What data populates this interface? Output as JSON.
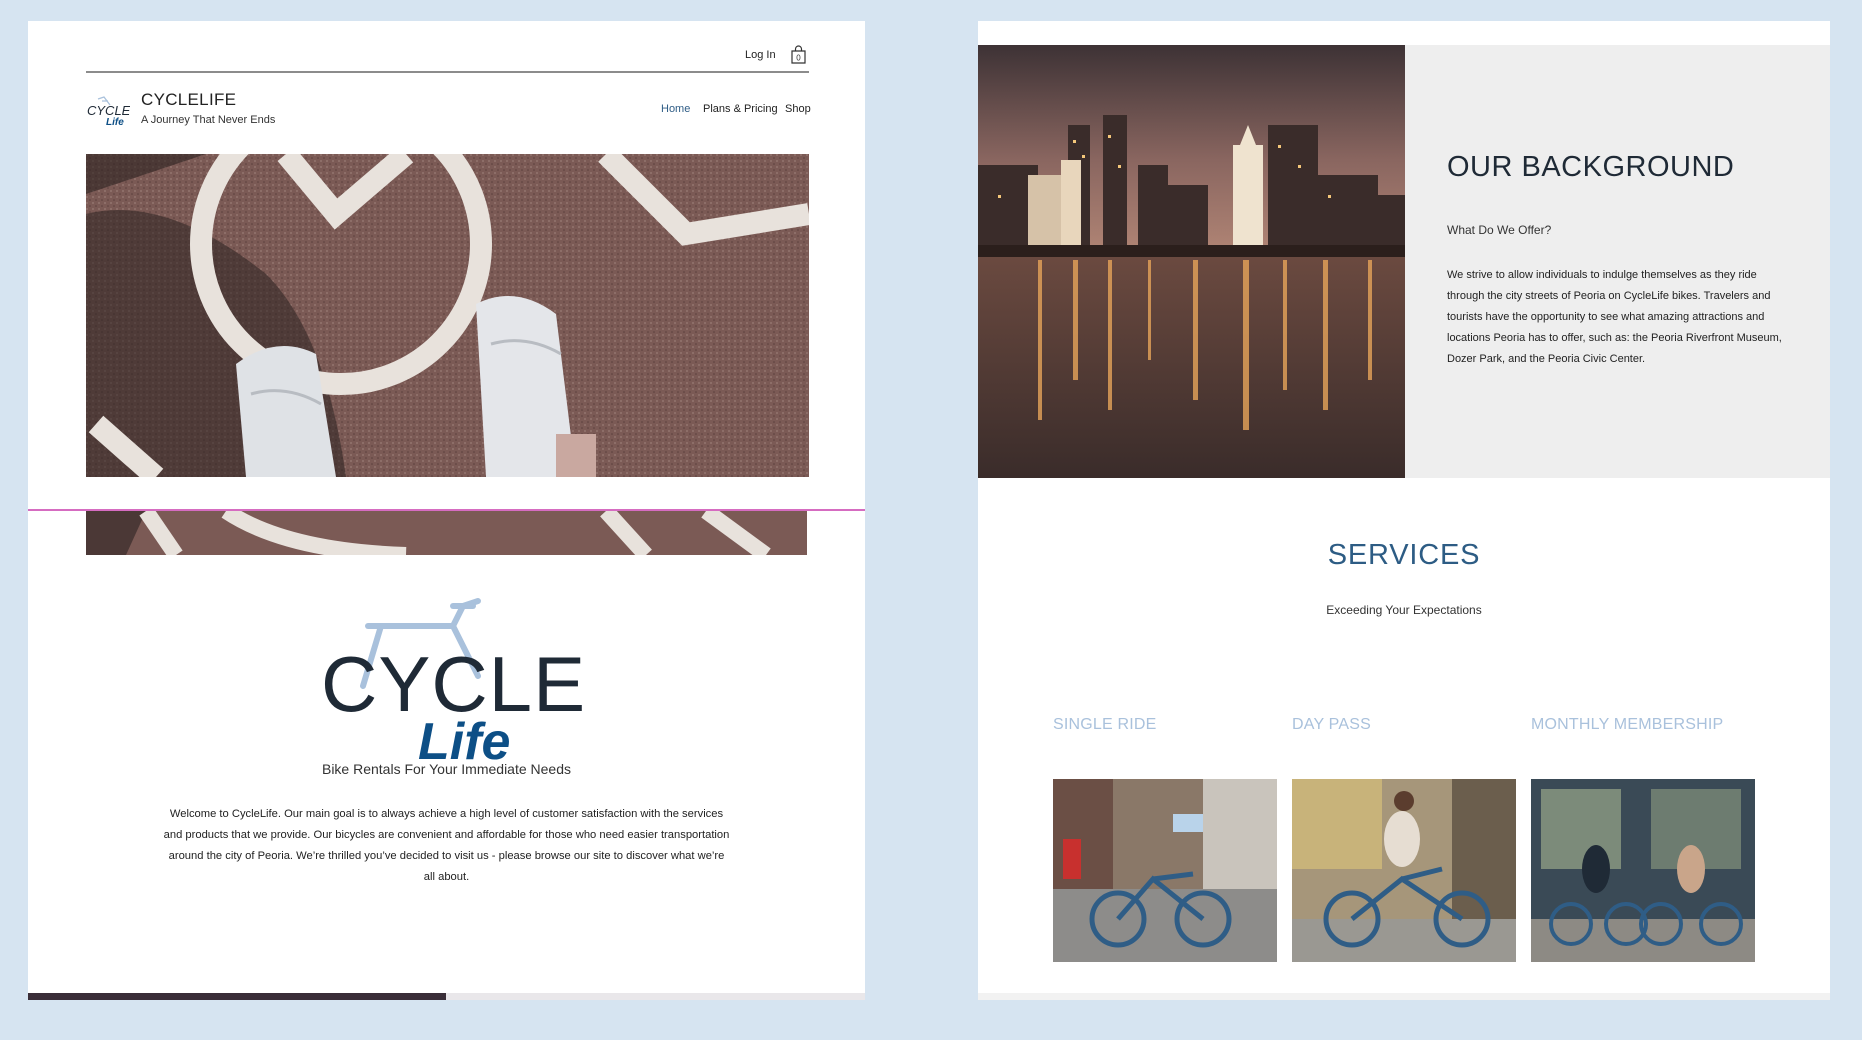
{
  "left": {
    "header": {
      "login_label": "Log In",
      "cart_count": "0",
      "title": "CYCLELIFE",
      "tagline": "A Journey That Never Ends",
      "nav": [
        {
          "label": "Home",
          "active": true
        },
        {
          "label": "Plans & Pricing",
          "active": false
        },
        {
          "label": "Shop",
          "active": false
        }
      ]
    },
    "logo_text": {
      "cycle": "CYCLE",
      "life": "Life"
    },
    "subtitle": "Bike Rentals For Your Immediate Needs",
    "welcome": "Welcome to CycleLife. Our main goal is to always achieve a high level of customer satisfaction with the services and products that we provide. Our bicycles are convenient and affordable for those who need easier transportation around the city of Peoria. We’re thrilled you’ve decided to visit us - please browse our site to discover what we’re all about."
  },
  "right": {
    "background": {
      "title": "OUR BACKGROUND",
      "subtitle": "What Do We Offer?",
      "text": "We strive to allow individuals to indulge themselves as they ride through the city streets of Peoria on CycleLife bikes. Travelers and tourists have the opportunity to see what amazing attractions and locations Peoria has to offer, such as: the Peoria Riverfront Museum, Dozer Park, and the Peoria Civic Center."
    },
    "services": {
      "title": "SERVICES",
      "subtitle": "Exceeding Your Expectations",
      "items": [
        {
          "label": "SINGLE RIDE"
        },
        {
          "label": "DAY PASS"
        },
        {
          "label": "MONTHLY MEMBERSHIP"
        }
      ]
    }
  },
  "colors": {
    "page_bg": "#d6e4f1",
    "brand_navy": "#1f2a36",
    "brand_blue": "#0d4f86",
    "accent_light_blue": "#a9c1dc",
    "nav_active": "#2f5d86",
    "guide_line": "#d66cc1"
  }
}
